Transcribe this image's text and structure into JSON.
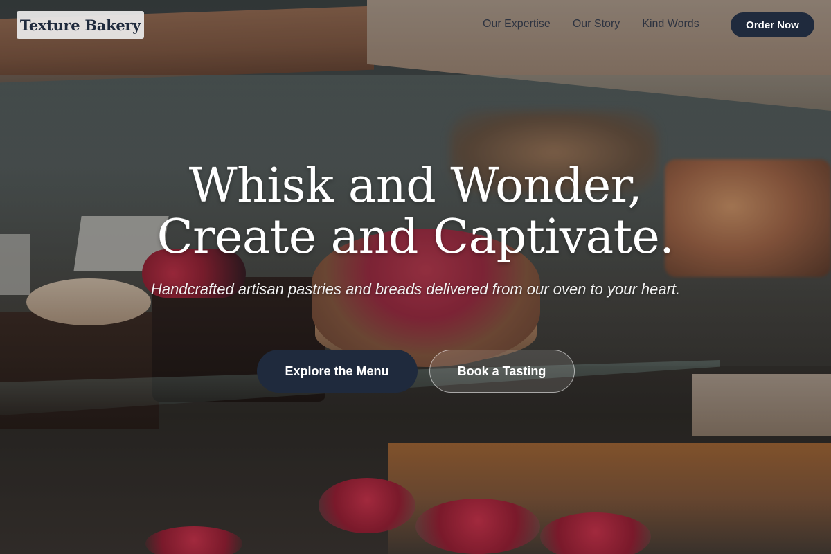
{
  "header": {
    "logo_text": "Texture Bakery",
    "nav": [
      {
        "label": "Our Expertise"
      },
      {
        "label": "Our Story"
      },
      {
        "label": "Kind Words"
      }
    ],
    "order_button_label": "Order Now"
  },
  "hero": {
    "title_line_1": "Whisk and Wonder,",
    "title_line_2": "Create and Captivate.",
    "subtitle": "Handcrafted artisan pastries and breads delivered from our oven to your heart.",
    "primary_cta_label": "Explore the Menu",
    "secondary_cta_label": "Book a Tasting",
    "background_image": "bakery-display-case-photo"
  },
  "colors": {
    "brand_navy": "#1f2a3d",
    "text_light": "#ffffff",
    "logo_bg": "#ececec"
  }
}
